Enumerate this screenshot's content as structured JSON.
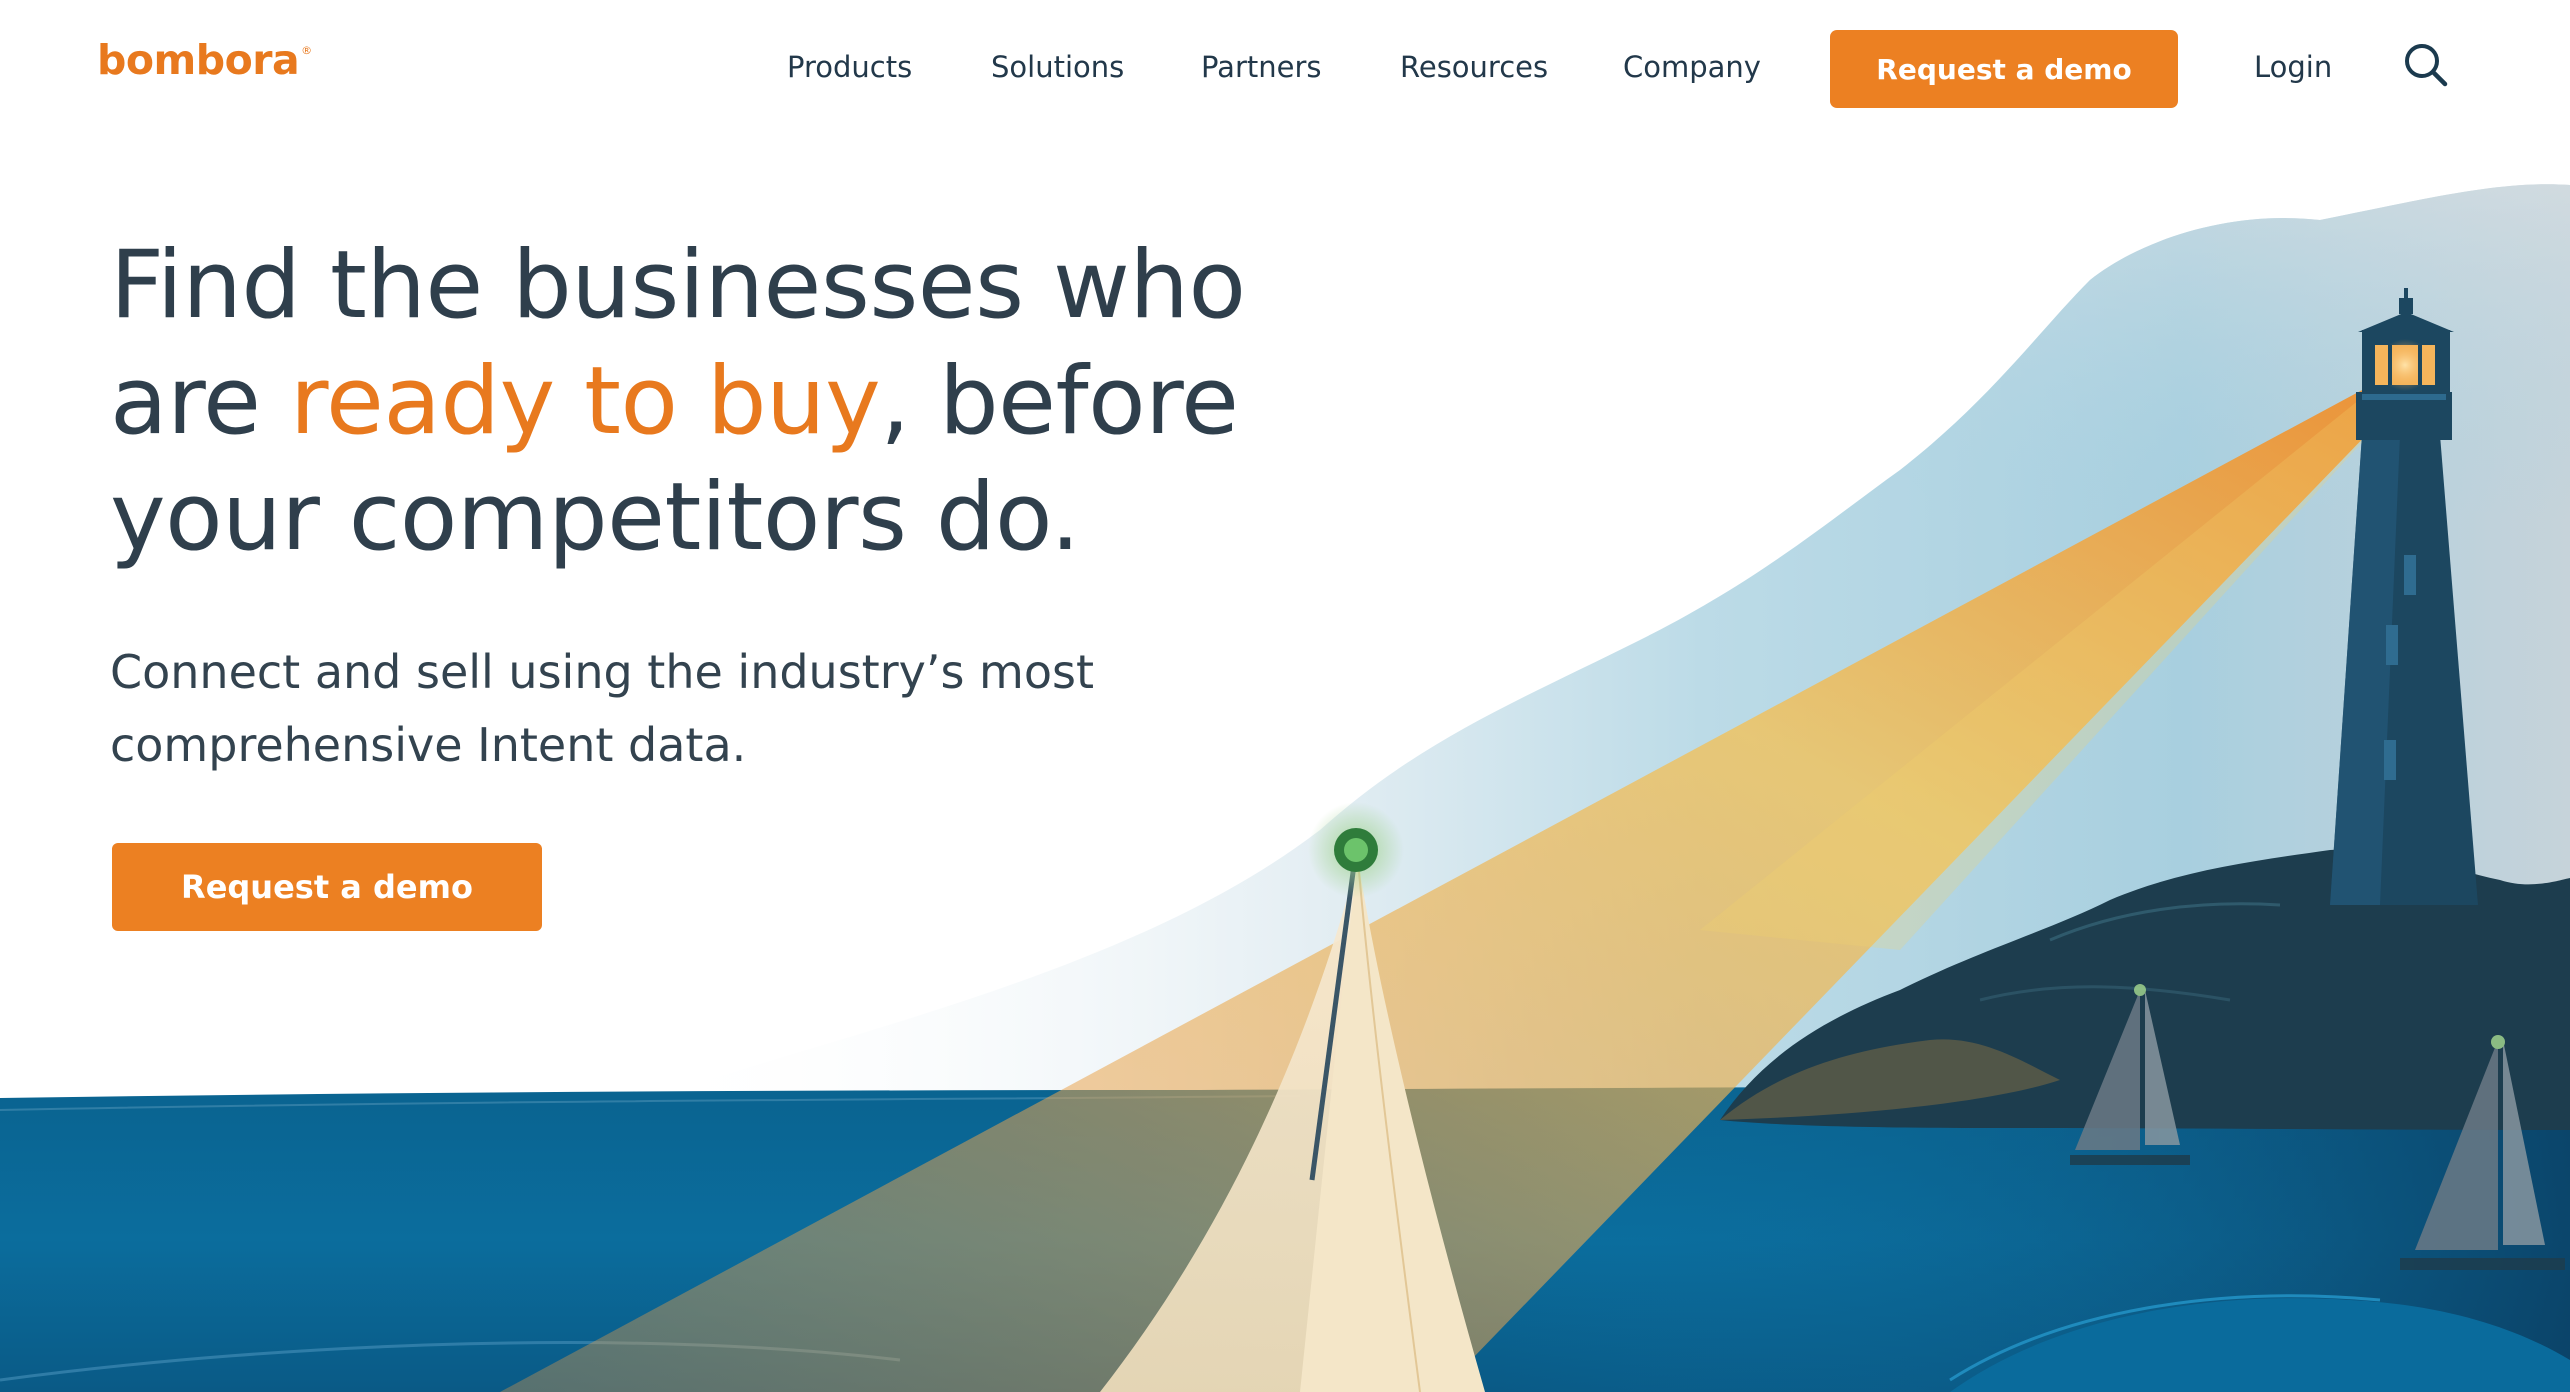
{
  "header": {
    "logo_text": "bombora",
    "logo_mark": "®",
    "nav": [
      "Products",
      "Solutions",
      "Partners",
      "Resources",
      "Company"
    ],
    "cta_label": "Request a demo",
    "login_label": "Login",
    "search_icon": "search-icon"
  },
  "hero": {
    "title_part1": "Find the businesses who are ",
    "title_accent": "ready to buy",
    "title_part2": ", before your competitors do.",
    "subtitle": "Connect and sell using the industry’s most comprehensive Intent data.",
    "cta_label": "Request a demo"
  },
  "colors": {
    "brand_orange": "#e8791e",
    "button_orange": "#ec8022",
    "text_dark": "#22384a",
    "sea_blue": "#0a5f8a",
    "sky_blue": "#a9d3e3",
    "lighthouse_navy": "#1c4760"
  },
  "illustration": {
    "name": "lighthouse-seascape",
    "elements": [
      "sky-wave",
      "sea",
      "lighthouse",
      "light-beam",
      "rocky-island",
      "sailboat-large",
      "sailboat-small-1",
      "sailboat-small-2",
      "buoy-light"
    ]
  }
}
